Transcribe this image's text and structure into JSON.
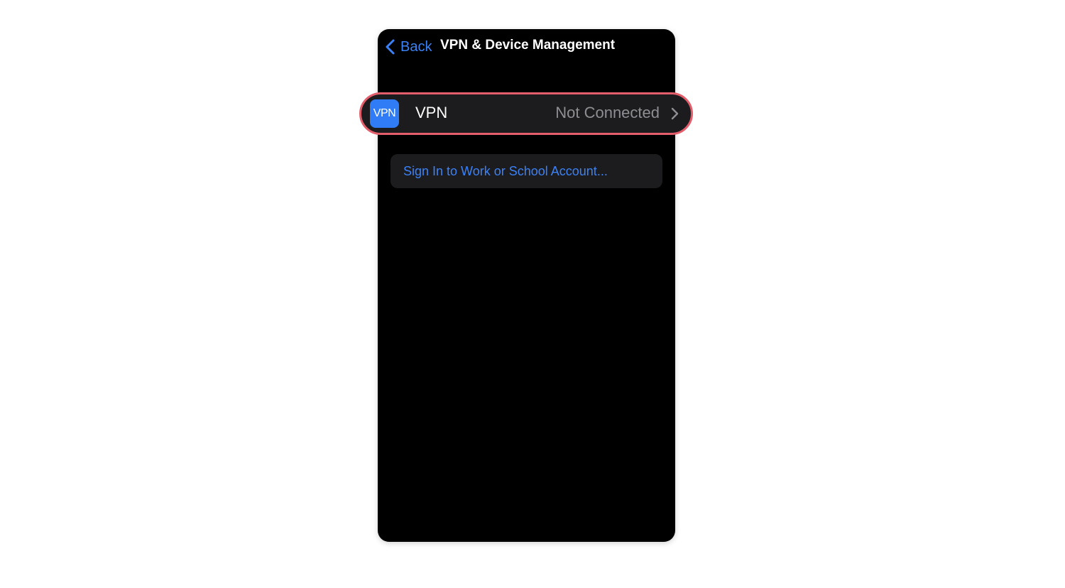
{
  "nav": {
    "back_label": "Back",
    "title": "VPN & Device Management"
  },
  "vpn": {
    "icon_text": "VPN",
    "label": "VPN",
    "status": "Not Connected",
    "icon_name": "chevron-right-icon"
  },
  "sign_in": {
    "label": "Sign In to Work or School Account..."
  },
  "colors": {
    "accent": "#3b82f6",
    "highlight": "#e35d6a",
    "background": "#000000",
    "cell": "#1c1c1e",
    "secondary_text": "#8e8e93",
    "vpn_icon_bg": "#2f7cf6"
  }
}
